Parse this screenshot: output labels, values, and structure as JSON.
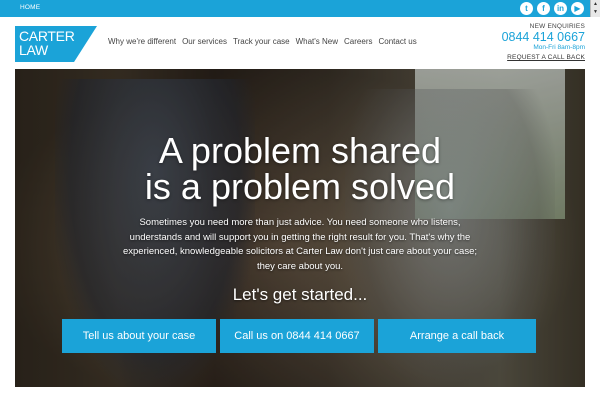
{
  "topbar": {
    "home_label": "HOME",
    "social_icons": [
      "twitter-icon",
      "facebook-icon",
      "linkedin-icon",
      "youtube-icon"
    ],
    "social_glyphs": [
      "t",
      "f",
      "in",
      "▶"
    ]
  },
  "header": {
    "logo_line1": "CARTER",
    "logo_line2": "LAW",
    "nav": [
      "Why we're different",
      "Our services",
      "Track your case",
      "What's New",
      "Careers",
      "Contact us"
    ],
    "enquiries_label": "NEW ENQUIRIES",
    "phone": "0844 414 0667",
    "hours": "Mon-Fri 8am-8pm",
    "callback_link": "REQUEST A CALL BACK"
  },
  "hero": {
    "title_line1": "A problem shared",
    "title_line2": "is a problem solved",
    "body": "Sometimes you need more than just advice. You need someone who listens, understands and will support you in getting the right result for you. That's why the experienced, knowledgeable solicitors at Carter Law don't just care about your case; they care about you.",
    "cta": "Let's get started...",
    "buttons": [
      "Tell us about your case",
      "Call us on 0844 414 0667",
      "Arrange a call back"
    ]
  },
  "colors": {
    "brand_blue": "#1ba3d8",
    "white": "#ffffff"
  }
}
